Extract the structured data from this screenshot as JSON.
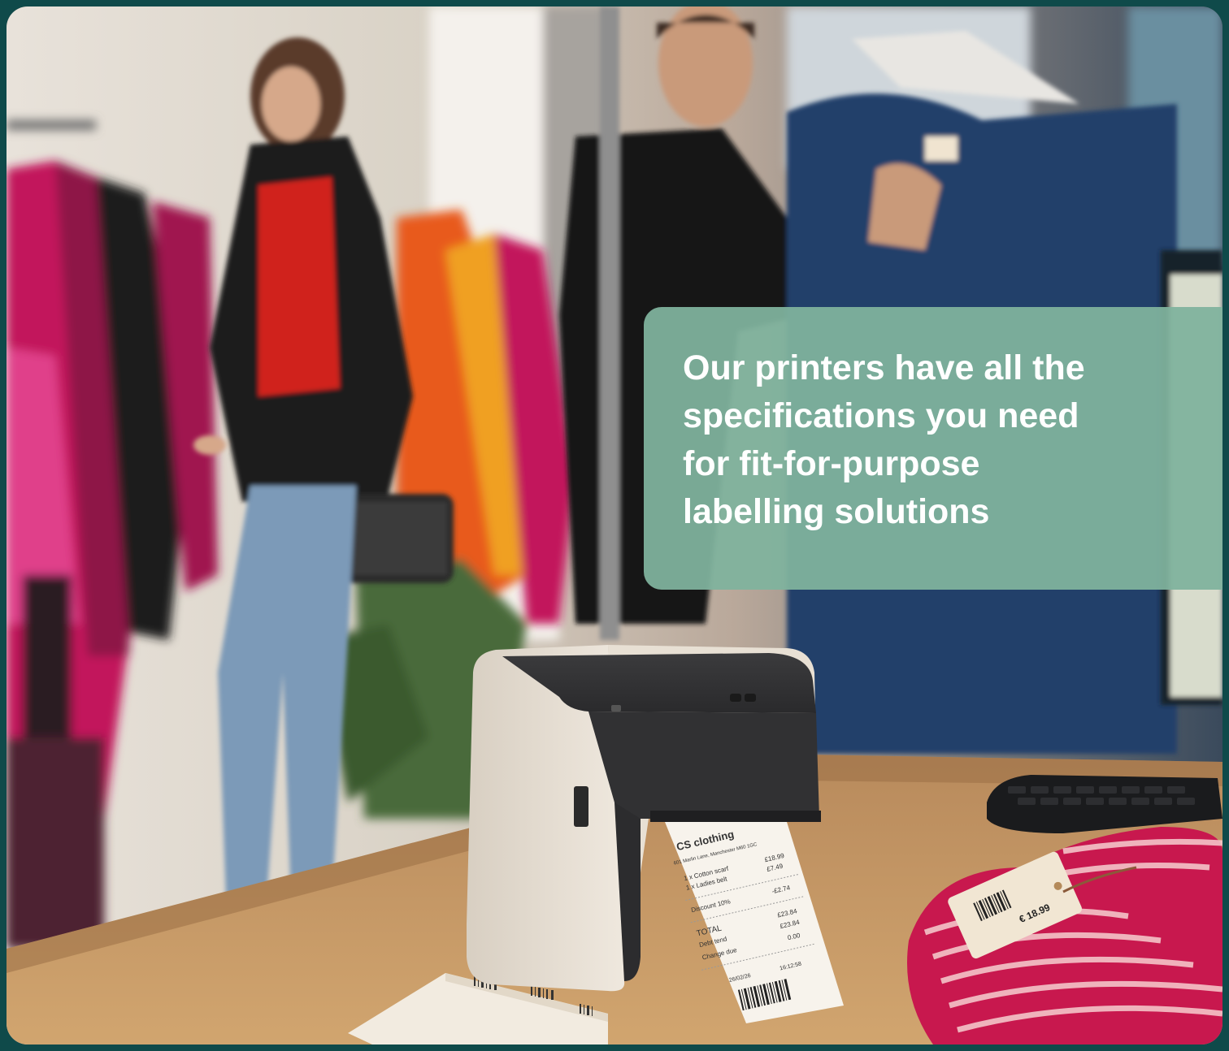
{
  "callout": {
    "lines": [
      "Our printers have all the",
      "specifications you need",
      "for fit-for-purpose",
      "labelling solutions"
    ]
  },
  "receipt": {
    "store": "CS clothing",
    "address": "601 Marlin Lane, Manchester M60 1GC",
    "items": [
      {
        "name": "1 x Cotton scarf",
        "price": "£18.99"
      },
      {
        "name": "1 x Ladies belt",
        "price": "£7.49"
      }
    ],
    "discount_label": "Discount 10%",
    "discount_value": "-£2.74",
    "total_label": "TOTAL",
    "total_value": "£23.84",
    "tender_label": "Debt tend",
    "tender_value": "£23.84",
    "change_label": "Change due",
    "change_value": "0.00",
    "date": "26/02/26",
    "time": "16:12:58"
  },
  "price_tag": {
    "price": "€ 18.99"
  },
  "colors": {
    "border": "#0f4a4a",
    "callout_bg": "#80b29d",
    "callout_text": "#ffffff"
  }
}
